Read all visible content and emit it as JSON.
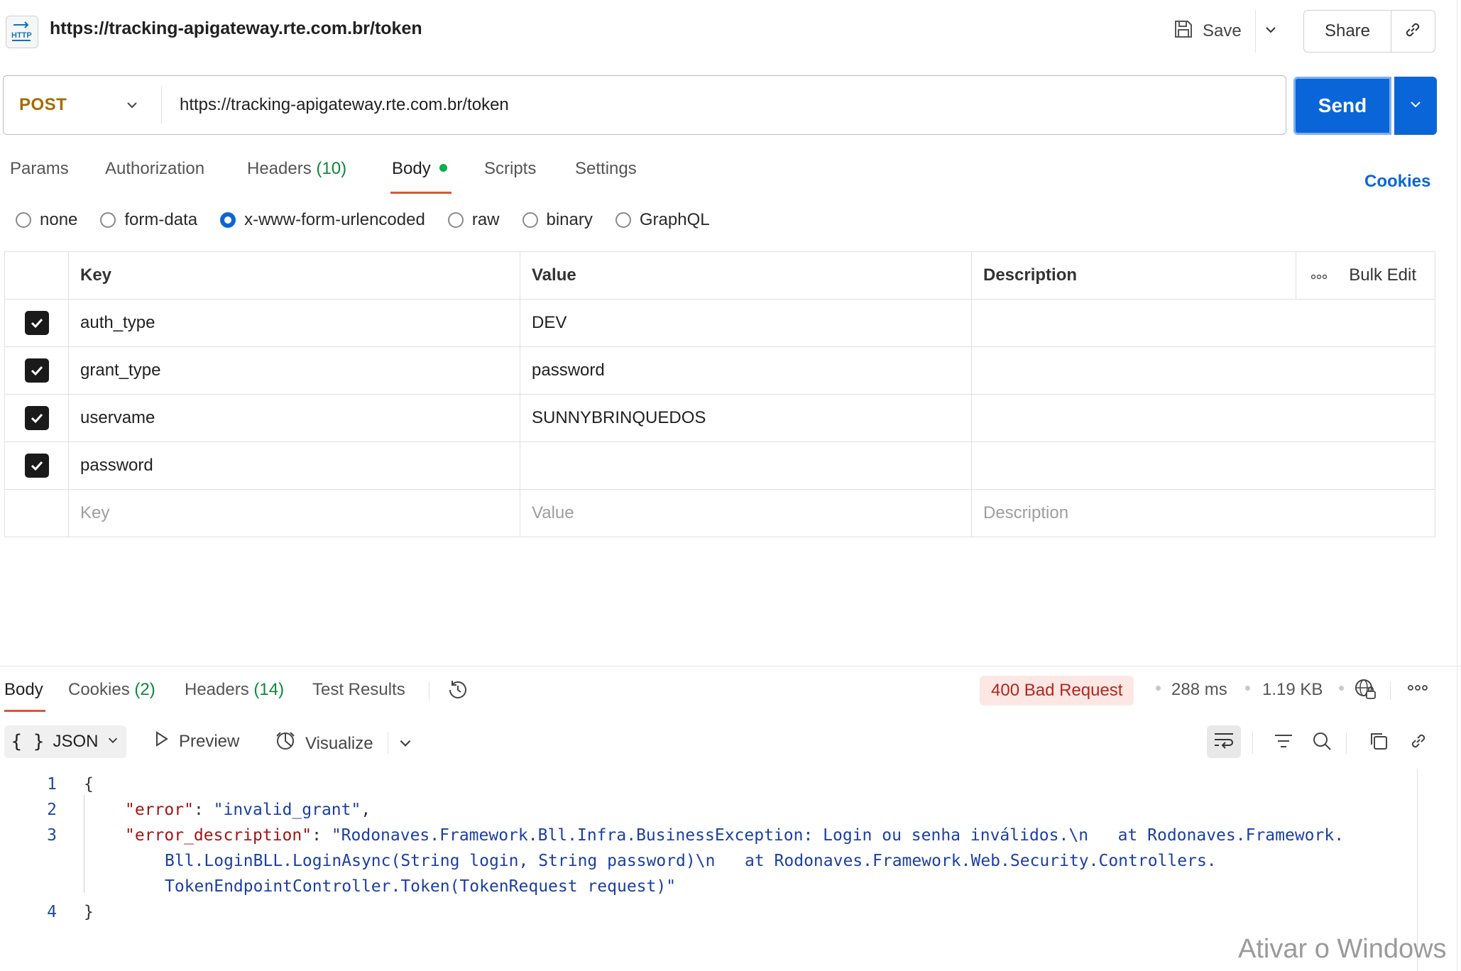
{
  "header": {
    "icon_label": "HTTP",
    "title": "https://tracking-apigateway.rte.com.br/token",
    "save_label": "Save",
    "share_label": "Share"
  },
  "request": {
    "method": "POST",
    "url": "https://tracking-apigateway.rte.com.br/token",
    "send_label": "Send"
  },
  "tabs": [
    {
      "label": "Params"
    },
    {
      "label": "Authorization"
    },
    {
      "label": "Headers",
      "count": "(10)"
    },
    {
      "label": "Body"
    },
    {
      "label": "Scripts"
    },
    {
      "label": "Settings"
    }
  ],
  "cookies_link": "Cookies",
  "body_types": [
    "none",
    "form-data",
    "x-www-form-urlencoded",
    "raw",
    "binary",
    "GraphQL"
  ],
  "body_type_selected": "x-www-form-urlencoded",
  "table": {
    "headers": {
      "key": "Key",
      "value": "Value",
      "description": "Description",
      "bulk_edit": "Bulk Edit"
    },
    "rows": [
      {
        "checked": true,
        "key": "auth_type",
        "value": "DEV",
        "description": ""
      },
      {
        "checked": true,
        "key": "grant_type",
        "value": "password",
        "description": ""
      },
      {
        "checked": true,
        "key": "uservame",
        "value": "SUNNYBRINQUEDOS",
        "description": ""
      },
      {
        "checked": true,
        "key": "password",
        "value": "",
        "description": ""
      }
    ],
    "placeholders": {
      "key": "Key",
      "value": "Value",
      "description": "Description"
    }
  },
  "response": {
    "tabs": [
      {
        "label": "Body"
      },
      {
        "label": "Cookies",
        "count": "(2)"
      },
      {
        "label": "Headers",
        "count": "(14)"
      },
      {
        "label": "Test Results"
      }
    ],
    "status": "400 Bad Request",
    "time": "288 ms",
    "size": "1.19 KB",
    "format": "JSON",
    "preview_label": "Preview",
    "visualize_label": "Visualize",
    "lines": [
      "1",
      "2",
      "3",
      "4"
    ],
    "code": {
      "open": "{",
      "error_key": "\"error\"",
      "error_value": "\"invalid_grant\"",
      "desc_key": "\"error_description\"",
      "desc_value_1": "\"Rodonaves.Framework.Bll.Infra.BusinessException: Login ou senha inválidos.\\n   at Rodonaves.Framework.",
      "desc_value_2": "Bll.LoginBLL.LoginAsync(String login, String password)\\n   at Rodonaves.Framework.Web.Security.Controllers.",
      "desc_value_3": "TokenEndpointController.Token(TokenRequest request)\"",
      "close": "}"
    }
  },
  "watermark": "Ativar o Windows"
}
